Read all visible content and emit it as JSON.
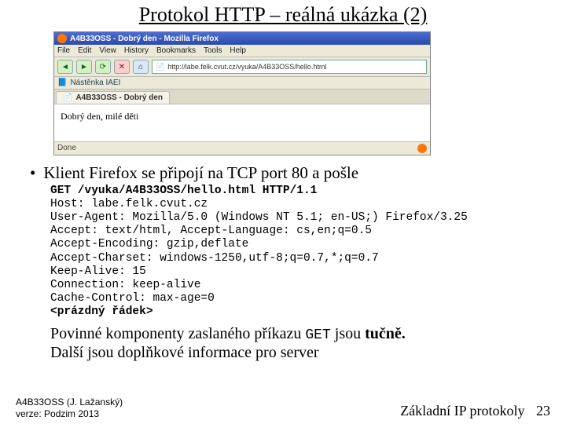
{
  "title": "Protokol HTTP – reálná ukázka (2)",
  "browser": {
    "window_title": "A4B33OSS - Dobrý den - Mozilla Firefox",
    "menus": [
      "File",
      "Edit",
      "View",
      "History",
      "Bookmarks",
      "Tools",
      "Help"
    ],
    "nav": {
      "back": "◄",
      "fwd": "►",
      "reload": "⟳",
      "stop": "✕",
      "home": "⌂"
    },
    "url_prefix": "http://labe.felk.cvut.cz/vyuka/A4B33OSS/hello.html",
    "bookmark": "Nástěnka IAEI",
    "tab_label": "A4B33OSS - Dobrý den",
    "page_text": "Dobrý den, milé děti",
    "status": "Done"
  },
  "bullet": "Klient Firefox se připojí na TCP port 80 a pošle",
  "code": [
    {
      "t": "GET /vyuka/A4B33OSS/hello.html HTTP/1.1",
      "b": true
    },
    {
      "t": "Host: labe.felk.cvut.cz",
      "b": false
    },
    {
      "t": "User-Agent: Mozilla/5.0 (Windows NT 5.1; en-US;) Firefox/3.25",
      "b": false
    },
    {
      "t": "Accept: text/html, Accept-Language: cs,en;q=0.5",
      "b": false
    },
    {
      "t": "Accept-Encoding: gzip,deflate",
      "b": false
    },
    {
      "t": "Accept-Charset: windows-1250,utf-8;q=0.7,*;q=0.7",
      "b": false
    },
    {
      "t": "Keep-Alive: 15",
      "b": false
    },
    {
      "t": "Connection: keep-alive",
      "b": false
    },
    {
      "t": "Cache-Control: max-age=0",
      "b": false
    },
    {
      "t": "<prázdný řádek>",
      "b": true
    }
  ],
  "para_pre": "Povinné komponenty zaslaného příkazu ",
  "para_mono": "GET",
  "para_mid": " jsou ",
  "para_bold": "tučně.",
  "para_line2": "Další jsou doplňkové informace pro server",
  "footer": {
    "left1": "A4B33OSS (J. Lažanský)",
    "left2": "verze: Podzim 2013",
    "right": "Základní IP protokoly",
    "page": "23"
  }
}
